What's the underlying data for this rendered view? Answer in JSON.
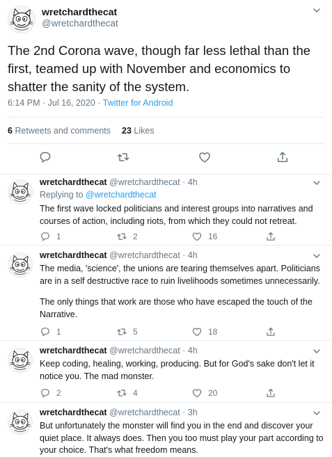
{
  "main_tweet": {
    "name": "wretchardthecat",
    "handle": "@wretchardthecat",
    "text": "The 2nd Corona wave, though far less lethal than the first, teamed up with November and economics to shatter the sanity of the system.",
    "time": "6:14 PM · Jul 16, 2020 · ",
    "source": "Twitter for Android",
    "retweets_count": "6",
    "retweets_label": "Retweets and comments",
    "likes_count": "23",
    "likes_label": "Likes"
  },
  "replies": [
    {
      "name": "wretchardthecat",
      "handle": "@wretchardthecat · 4h",
      "replying_prefix": "Replying to ",
      "replying_to": "@wretchardthecat",
      "paragraphs": [
        "The first wave locked politicians and interest groups into narratives and courses of action, including riots, from which they could not retreat."
      ],
      "comments": "1",
      "retweets": "2",
      "likes": "16"
    },
    {
      "name": "wretchardthecat",
      "handle": "@wretchardthecat · 4h",
      "paragraphs": [
        "The media, 'science', the unions are tearing themselves apart.  Politicians are in a self destructive race to ruin livelihoods sometimes unnecessarily.",
        "The only things that work are those who have escaped the touch of the Narrative."
      ],
      "comments": "1",
      "retweets": "5",
      "likes": "18"
    },
    {
      "name": "wretchardthecat",
      "handle": "@wretchardthecat · 4h",
      "paragraphs": [
        "Keep coding, healing, working, producing.  But for God's sake don't let it notice you. The mad monster."
      ],
      "comments": "2",
      "retweets": "4",
      "likes": "20"
    },
    {
      "name": "wretchardthecat",
      "handle": "@wretchardthecat · 3h",
      "paragraphs": [
        "But unfortunately the monster will find you in the end and discover your quiet place. It always does. Then you too must play your part according to your choice. That's what freedom means."
      ]
    }
  ],
  "icons": {
    "comment": "comment-icon",
    "retweet": "retweet-icon",
    "like": "heart-icon",
    "share": "share-icon",
    "caret": "chevron-down-icon",
    "avatar": "cat-cartoon-avatar"
  },
  "colors": {
    "link": "#1da1f2",
    "secondary_text": "#657786",
    "primary_text": "#14171a",
    "divider": "#e6ecf0"
  }
}
